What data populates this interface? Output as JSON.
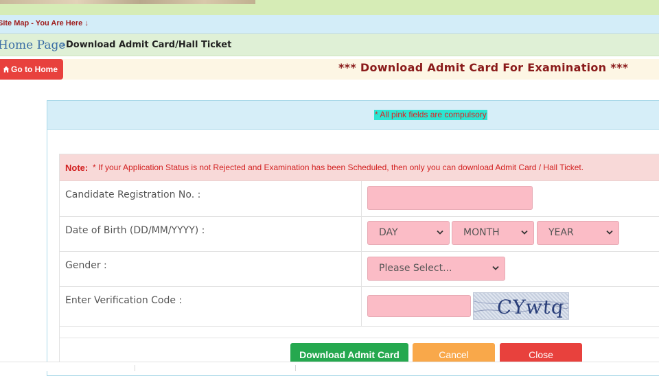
{
  "header": {
    "sitemap_label": "Site Map - You Are Here ↓",
    "breadcrumb_home": "Home Page",
    "breadcrumb_sep": ">",
    "breadcrumb_current": "Download Admit Card/Hall Ticket",
    "home_button": "Go to Home",
    "page_title": "*** Download Admit Card For Examination ***"
  },
  "form": {
    "compulsory_note": "* All pink fields are compulsory",
    "note_label": "Note:",
    "note_text": "* If your Application Status is not Rejected and Examination has been Scheduled, then only you can download Admit Card / Hall Ticket.",
    "registration_label": "Candidate Registration No. :",
    "dob_label": "Date of Birth (DD/MM/YYYY) :",
    "dob_day": "DAY",
    "dob_month": "MONTH",
    "dob_year": "YEAR",
    "gender_label": "Gender :",
    "gender_value": "Please Select...",
    "verification_label": "Enter Verification Code :",
    "captcha_text": "CYwtq"
  },
  "actions": {
    "download_label": "Download Admit Card",
    "cancel_label": "Cancel",
    "close_label": "Close"
  },
  "colors": {
    "pink_field": "#fbbcc6",
    "download": "#25a84f",
    "cancel": "#f9a84a",
    "close": "#e8413d",
    "title": "#8a1a1a"
  }
}
